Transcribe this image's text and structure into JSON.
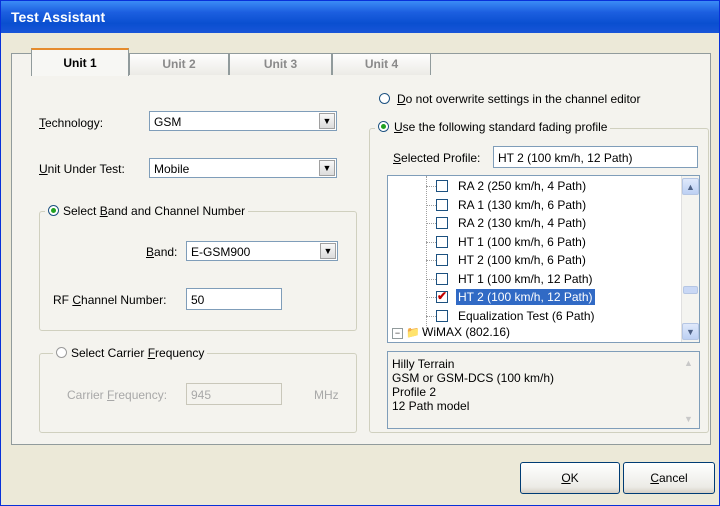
{
  "window": {
    "title": "Test Assistant"
  },
  "tabs": [
    {
      "label": "Unit 1"
    },
    {
      "label": "Unit 2"
    },
    {
      "label": "Unit 3"
    },
    {
      "label": "Unit 4"
    }
  ],
  "left": {
    "technology": {
      "label_u": "T",
      "label_rest": "echnology:",
      "value": "GSM"
    },
    "uut": {
      "label_pre": "",
      "label_u": "U",
      "label_rest": "nit Under Test:",
      "value": "Mobile"
    },
    "band_group": {
      "label_pre": "Select ",
      "label_u": "B",
      "label_rest": "and and Channel Number"
    },
    "band": {
      "label_u": "B",
      "label_rest": "and:",
      "value": "E-GSM900"
    },
    "rf": {
      "label_pre": "RF ",
      "label_u": "C",
      "label_rest": "hannel Number:",
      "value": "50"
    },
    "carrier_group": {
      "label_pre": "Select Carrier ",
      "label_u": "F",
      "label_rest": "requency"
    },
    "carrier": {
      "label_pre": "Carrier ",
      "label_u": "F",
      "label_rest": "requency:",
      "value": "945",
      "unit": "MHz"
    }
  },
  "right": {
    "no_overwrite": {
      "label_u": "D",
      "label_rest": "o not overwrite settings in the channel editor"
    },
    "use_profile": {
      "label_u": "U",
      "label_rest": "se the following standard fading profile"
    },
    "selected_profile": {
      "label_u": "S",
      "label_rest": "elected Profile:",
      "value": "HT 2 (100 km/h, 12 Path)"
    },
    "profiles": [
      {
        "label": "RA 2 (250 km/h, 4 Path)",
        "checked": false
      },
      {
        "label": "RA 1 (130 km/h, 6 Path)",
        "checked": false
      },
      {
        "label": "RA 2 (130 km/h, 4 Path)",
        "checked": false
      },
      {
        "label": "HT 1 (100 km/h, 6 Path)",
        "checked": false
      },
      {
        "label": "HT 2 (100 km/h, 6 Path)",
        "checked": false
      },
      {
        "label": "HT 1 (100 km/h, 12 Path)",
        "checked": false
      },
      {
        "label": "HT 2 (100 km/h, 12 Path)",
        "checked": true
      },
      {
        "label": "Equalization Test (6 Path)",
        "checked": false
      }
    ],
    "wimax": "WiMAX (802.16)",
    "description": [
      "Hilly Terrain",
      "GSM or GSM-DCS (100 km/h)",
      "Profile 2",
      "12 Path model"
    ]
  },
  "buttons": {
    "ok": {
      "label_u": "O",
      "label_rest": "K"
    },
    "cancel": {
      "label_u": "C",
      "label_rest": "ancel"
    }
  }
}
